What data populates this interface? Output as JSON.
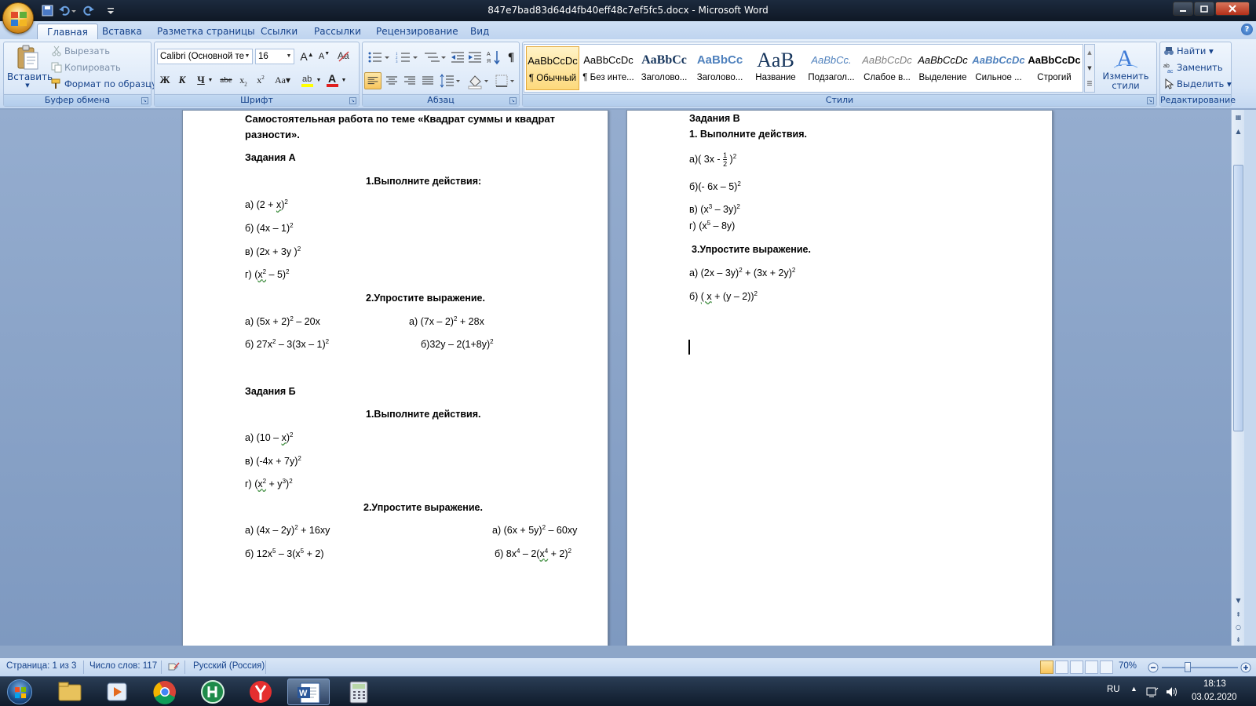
{
  "window": {
    "title": "847e7bad83d64d4fb40eff48c7ef5fc5.docx - Microsoft Word"
  },
  "tabs": [
    "Главная",
    "Вставка",
    "Разметка страницы",
    "Ссылки",
    "Рассылки",
    "Рецензирование",
    "Вид"
  ],
  "ribbon": {
    "clipboard": {
      "paste": "Вставить",
      "cut": "Вырезать",
      "copy": "Копировать",
      "format_painter": "Формат по образцу",
      "label": "Буфер обмена"
    },
    "font": {
      "name": "Calibri (Основной те",
      "size": "16",
      "label": "Шрифт"
    },
    "paragraph": {
      "label": "Абзац"
    },
    "styles": {
      "label": "Стили",
      "items": [
        {
          "sample": "AaBbCcDc",
          "name": "¶ Обычный"
        },
        {
          "sample": "AaBbCcDc",
          "name": "¶ Без инте..."
        },
        {
          "sample": "AaBbCc",
          "name": "Заголово..."
        },
        {
          "sample": "AaBbCc",
          "name": "Заголово..."
        },
        {
          "sample": "AaB",
          "name": "Название"
        },
        {
          "sample": "AaBbCc.",
          "name": "Подзагол..."
        },
        {
          "sample": "AaBbCcDc",
          "name": "Слабое в..."
        },
        {
          "sample": "AaBbCcDc",
          "name": "Выделение"
        },
        {
          "sample": "AaBbCcDc",
          "name": "Сильное ..."
        },
        {
          "sample": "AaBbCcDc",
          "name": "Строгий"
        }
      ],
      "change_styles": "Изменить стили"
    },
    "editing": {
      "find": "Найти",
      "replace": "Заменить",
      "select": "Выделить",
      "label": "Редактирование"
    }
  },
  "document": {
    "page1": {
      "title_line1": "Самостоятельная работа по теме  «Квадрат суммы и квадрат",
      "title_line2": "разности».",
      "section_a": "Задания А",
      "a_task1": "1.Выполните действия:",
      "a_task2": "2.Упростите выражение.",
      "section_b": "Задания Б",
      "b_task1": "1.Выполните действия.",
      "b_task2": "2.Упростите выражение."
    },
    "page2": {
      "section_c": "Задания В",
      "c_task1": "1. Выполните действия.",
      "c_task3": "3.Упростите выражение."
    }
  },
  "status": {
    "page": "Страница: 1 из 3",
    "words": "Число слов: 117",
    "language": "Русский (Россия)",
    "zoom": "70%"
  },
  "taskbar": {
    "lang": "RU",
    "time": "18:13",
    "date": "03.02.2020"
  }
}
